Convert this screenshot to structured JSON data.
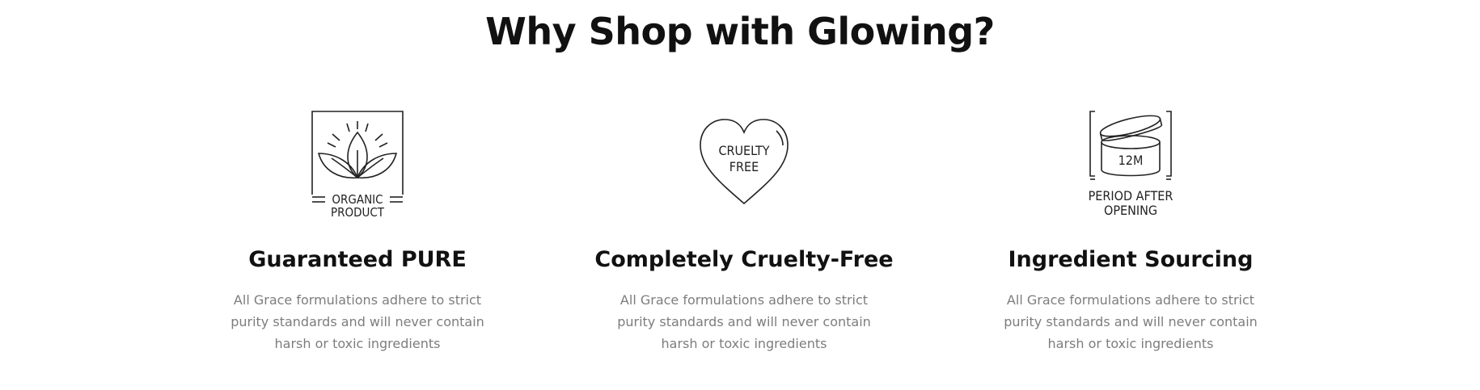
{
  "section": {
    "title": "Why Shop with Glowing?"
  },
  "features": [
    {
      "icon": "organic-product-leaf-icon",
      "icon_text_line1": "ORGANIC",
      "icon_text_line2": "PRODUCT",
      "title": "Guaranteed PURE",
      "description": "All Grace formulations adhere to strict purity standards and will never contain harsh or toxic ingredients"
    },
    {
      "icon": "cruelty-free-heart-icon",
      "icon_text_line1": "CRUELTY",
      "icon_text_line2": "FREE",
      "title": "Completely Cruelty-Free",
      "description": "All Grace formulations adhere to strict purity standards and will never contain harsh or toxic ingredients"
    },
    {
      "icon": "period-after-opening-jar-icon",
      "icon_text_jar": "12M",
      "icon_text_line1": "PERIOD AFTER",
      "icon_text_line2": "OPENING",
      "title": "Ingredient Sourcing",
      "description": "All Grace formulations adhere to strict purity standards and will never contain harsh or toxic ingredients"
    }
  ],
  "colors": {
    "heading": "#111111",
    "body_text": "#7d7d7d",
    "icon_stroke": "#222222",
    "background": "#ffffff"
  }
}
